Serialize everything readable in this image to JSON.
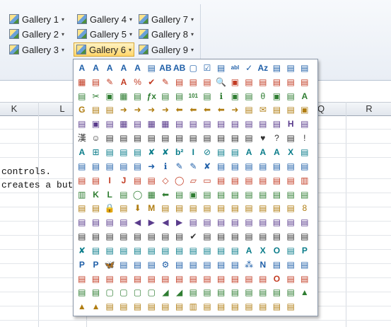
{
  "ribbon": {
    "galleries": [
      {
        "label": "Gallery 1"
      },
      {
        "label": "Gallery 2"
      },
      {
        "label": "Gallery 3"
      },
      {
        "label": "Gallery 4"
      },
      {
        "label": "Gallery 5"
      },
      {
        "label": "Gallery 6"
      },
      {
        "label": "Gallery 7"
      },
      {
        "label": "Gallery 8"
      },
      {
        "label": "Gallery 9"
      }
    ],
    "dropdown_arrow": "▾"
  },
  "sheet": {
    "columns": [
      {
        "label": "K"
      },
      {
        "label": "L"
      },
      {
        "label": "Q"
      },
      {
        "label": "R"
      }
    ],
    "cells": [
      {
        "text": "controls."
      },
      {
        "text": "creates a but"
      }
    ]
  },
  "gallery_popup": {
    "icons": [
      "A",
      "A",
      "A",
      "A",
      "A",
      "▤",
      "AB",
      "AB",
      "▢",
      "☑",
      "▤",
      "abl",
      "✓",
      "Aᴢ",
      "▤",
      "▤",
      "▤",
      "▦",
      "▤",
      "✎",
      "A",
      "%",
      "✔",
      "✎",
      "▤",
      "▤",
      "▤",
      "🔍",
      "▣",
      "▤",
      "▤",
      "▤",
      "▤",
      "▤",
      "▤",
      "✂",
      "▣",
      "▦",
      "▤",
      "ƒx",
      "▤",
      "▤",
      "101",
      "▤",
      "ℹ",
      "▣",
      "▤",
      "θ",
      "▣",
      "▤",
      "A",
      "G",
      "▤",
      "▤",
      "➜",
      "➜",
      "➜",
      "➜",
      "⬅",
      "⬅",
      "⬅",
      "⬅",
      "➜",
      "▤",
      "✉",
      "▤",
      "▤",
      "▣",
      "▤",
      "▣",
      "▤",
      "▦",
      "▤",
      "▦",
      "▦",
      "▤",
      "▤",
      "▤",
      "▤",
      "▤",
      "▤",
      "▤",
      "▤",
      "H",
      "▤",
      "漢",
      "☺",
      "▤",
      "▤",
      "▤",
      "▤",
      "▤",
      "▤",
      "▤",
      "▤",
      "▤",
      "▤",
      "▤",
      "♥",
      "?",
      "▤",
      "!",
      "A",
      "⊞",
      "▤",
      "▤",
      "▤",
      "✘",
      "✘",
      "b²",
      "I",
      "⊘",
      "▤",
      "▤",
      "A",
      "A",
      "A",
      "X",
      "▤",
      "▤",
      "▤",
      "▤",
      "▤",
      "▤",
      "➜",
      "ℹ",
      "✎",
      "✎",
      "✘",
      "▤",
      "▤",
      "▤",
      "▤",
      "▤",
      "▤",
      "▤",
      "▤",
      "▤",
      "I",
      "J",
      "▤",
      "▤",
      "◇",
      "◯",
      "▱",
      "▭",
      "▤",
      "▤",
      "▤",
      "▤",
      "▤",
      "▤",
      "▥",
      "▥",
      "K",
      "L",
      "▤",
      "◯",
      "▦",
      "⬅",
      "▤",
      "▣",
      "▤",
      "▤",
      "▤",
      "▤",
      "▤",
      "▤",
      "▤",
      "▤",
      "▤",
      "▤",
      "🔒",
      "▤",
      "⬇",
      "M",
      "▤",
      "▤",
      "▤",
      "▤",
      "▤",
      "▤",
      "▤",
      "▤",
      "▤",
      "▤",
      "8",
      "▤",
      "▤",
      "▤",
      "▤",
      "◀",
      "▶",
      "◀",
      "▶",
      "▤",
      "▤",
      "▤",
      "▤",
      "▤",
      "▤",
      "▤",
      "▤",
      "▤",
      "▤",
      "▤",
      "▤",
      "▤",
      "▤",
      "▤",
      "▤",
      "▤",
      "✔",
      "▤",
      "▤",
      "▤",
      "▤",
      "▤",
      "▤",
      "▤",
      "▤",
      "✘",
      "▤",
      "▤",
      "▤",
      "▤",
      "▤",
      "▤",
      "▤",
      "▤",
      "▤",
      "▤",
      "▤",
      "A",
      "X",
      "O",
      "▤",
      "P",
      "P",
      "P",
      "🦋",
      "▤",
      "▤",
      "▤",
      "⚙",
      "▤",
      "▤",
      "▤",
      "▤",
      "▤",
      "⁂",
      "N",
      "▤",
      "▤",
      "▤",
      "▤",
      "▤",
      "▤",
      "▤",
      "▤",
      "▤",
      "▤",
      "▤",
      "▤",
      "▤",
      "▤",
      "▤",
      "▤",
      "▤",
      "O",
      "▤",
      "▤",
      "▤",
      "▤",
      "▢",
      "▢",
      "▢",
      "▢",
      "◢",
      "◢",
      "▤",
      "▤",
      "▤",
      "▤",
      "▤",
      "▤",
      "▤",
      "▤",
      "▲",
      "▲",
      "▲",
      "▤",
      "▤",
      "▤",
      "▤",
      "▤",
      "▤",
      "▥",
      "▤",
      "▤",
      "▤",
      "▤",
      "▤",
      "▤",
      "▤"
    ]
  }
}
